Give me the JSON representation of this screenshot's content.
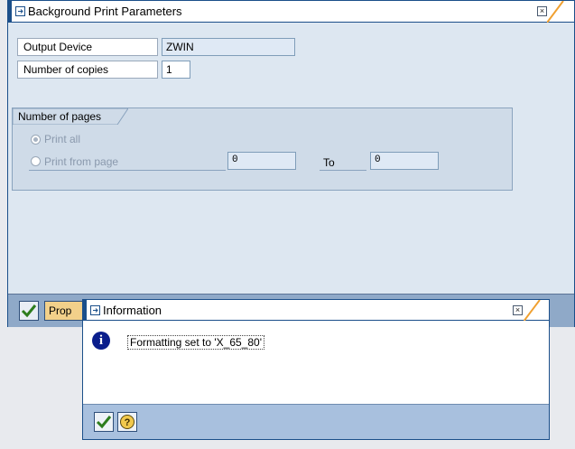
{
  "main_dialog": {
    "title": "Background Print Parameters",
    "fields": {
      "output_device": {
        "label": "Output Device",
        "value": "ZWIN"
      },
      "number_of_copies": {
        "label": "Number of copies",
        "value": "1"
      }
    },
    "pages_group": {
      "title": "Number of pages",
      "print_all_label": "Print all",
      "print_from_label": "Print from page",
      "from_value": "0",
      "to_label": "To",
      "to_value": "0",
      "selected": "print_all"
    },
    "footer": {
      "properties_label": "Prop"
    }
  },
  "info_dialog": {
    "title": "Information",
    "message": "Formatting set to 'X_65_80'"
  },
  "colors": {
    "title_border": "#1b4f8a",
    "accent_orange": "#f0a030",
    "body_bg": "#dde7f1",
    "group_bg": "#cfdbe8",
    "footer_bg": "#8fa9c8",
    "button_yellow": "#f2d08a",
    "check_green": "#2e7d1e"
  },
  "icons": [
    "window-icon",
    "close-icon",
    "check-icon",
    "info-icon",
    "help-icon"
  ]
}
